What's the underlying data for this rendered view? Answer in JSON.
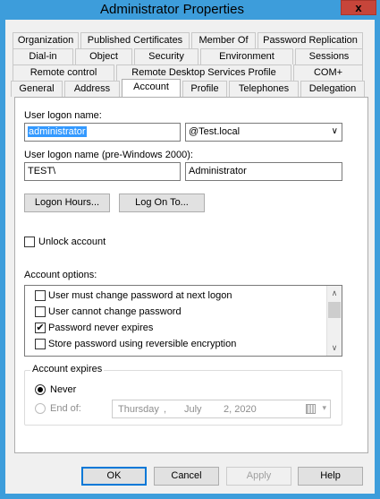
{
  "window": {
    "title": "Administrator Properties",
    "close_label": "x"
  },
  "tabs": {
    "row1": [
      "Organization",
      "Published Certificates",
      "Member Of",
      "Password Replication"
    ],
    "row2": [
      "Dial-in",
      "Object",
      "Security",
      "Environment",
      "Sessions"
    ],
    "row3": [
      "Remote control",
      "Remote Desktop Services Profile",
      "COM+"
    ],
    "row4": [
      "General",
      "Address",
      "Account",
      "Profile",
      "Telephones",
      "Delegation"
    ],
    "active": "Account"
  },
  "account": {
    "logon_name_label": "User logon name:",
    "logon_name_value": "administrator",
    "domain_suffix": "@Test.local",
    "pre2000_label": "User logon name (pre-Windows 2000):",
    "pre2000_domain": "TEST\\",
    "pre2000_name": "Administrator",
    "logon_hours_button": "Logon Hours...",
    "logon_to_button": "Log On To...",
    "unlock_label": "Unlock account",
    "options_label": "Account options:",
    "options": [
      {
        "label": "User must change password at next logon",
        "checked": false
      },
      {
        "label": "User cannot change password",
        "checked": false
      },
      {
        "label": "Password never expires",
        "checked": true
      },
      {
        "label": "Store password using reversible encryption",
        "checked": false
      }
    ],
    "expires_title": "Account expires",
    "never_label": "Never",
    "end_of_label": "End of:",
    "date_day": "Thursday",
    "date_sep": ",",
    "date_month": "July",
    "date_num": "2, 2020"
  },
  "footer": {
    "ok": "OK",
    "cancel": "Cancel",
    "apply": "Apply",
    "help": "Help"
  },
  "colors": {
    "accent": "#3d9ddb",
    "selection": "#3399ff",
    "close": "#c7453a"
  }
}
